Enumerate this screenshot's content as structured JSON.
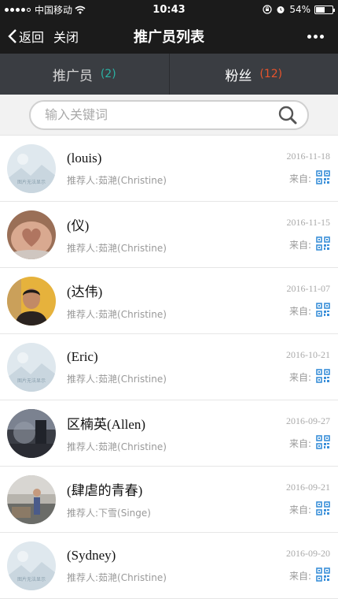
{
  "status_bar": {
    "carrier": "中国移动",
    "time": "10:43",
    "battery": "54%",
    "battery_level": 0.54
  },
  "nav": {
    "back_label": "返回",
    "close_label": "关闭",
    "title": "推广员列表"
  },
  "tabs": [
    {
      "label": "推广员",
      "count": "(2)",
      "count_color": "#2bb3a4"
    },
    {
      "label": "粉丝",
      "count": "(12)",
      "count_color": "#e8542c"
    }
  ],
  "search": {
    "placeholder": "输入关键词"
  },
  "source_label": "来自:",
  "qr_color": "#3a8fd9",
  "rows": [
    {
      "name": "(louis)",
      "referrer": "推荐人:茹滟(Christine)",
      "date": "2016-11-18",
      "avatar": "placeholder",
      "placeholder_text": "图片无法显示"
    },
    {
      "name": "(仪)",
      "referrer": "推荐人:茹滟(Christine)",
      "date": "2016-11-15",
      "avatar": "hands-heart"
    },
    {
      "name": "(达伟)",
      "referrer": "推荐人:茹滟(Christine)",
      "date": "2016-11-07",
      "avatar": "man-portrait"
    },
    {
      "name": "(Eric)",
      "referrer": "推荐人:茹滟(Christine)",
      "date": "2016-10-21",
      "avatar": "placeholder",
      "placeholder_text": "图片无法显示"
    },
    {
      "name": "区楠英(Allen)",
      "referrer": "推荐人:茹滟(Christine)",
      "date": "2016-09-27",
      "avatar": "dark-glass"
    },
    {
      "name": "(肆虐的青春)",
      "referrer": "推荐人:下雪(Singe)",
      "date": "2016-09-21",
      "avatar": "man-outdoor"
    },
    {
      "name": "(Sydney)",
      "referrer": "推荐人:茹滟(Christine)",
      "date": "2016-09-20",
      "avatar": "placeholder",
      "placeholder_text": "图片无法显示"
    }
  ]
}
